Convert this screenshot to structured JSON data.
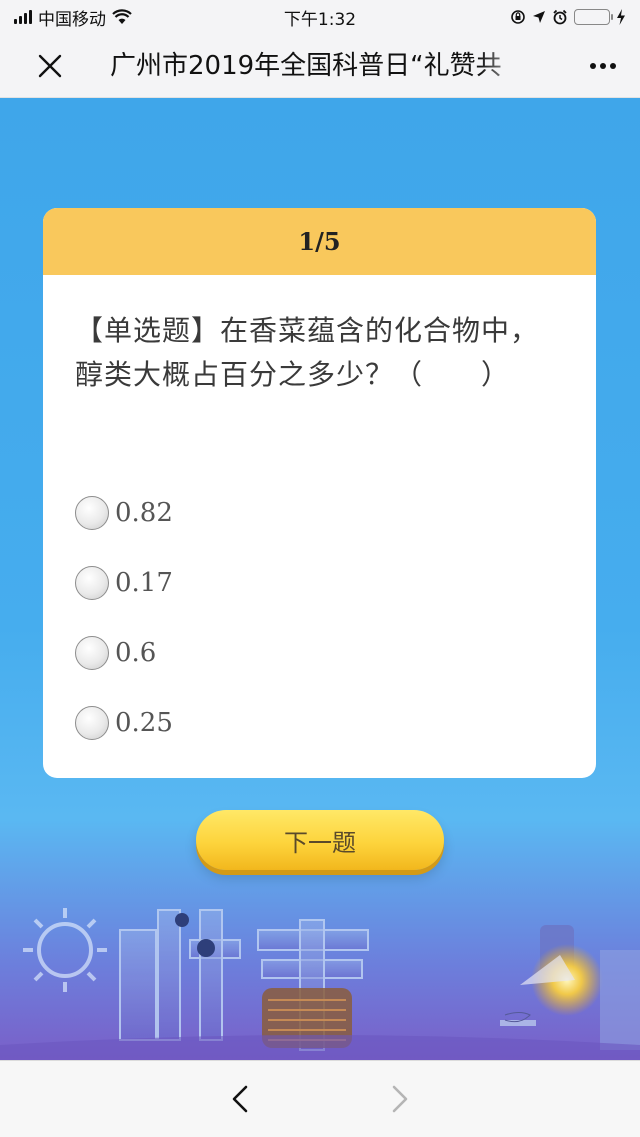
{
  "status_bar": {
    "carrier": "中国移动",
    "time": "下午1:32"
  },
  "nav_bar": {
    "title": "广州市2019年全国科普日“礼赞共"
  },
  "quiz": {
    "progress": "1/5",
    "question": "【单选题】在香菜蕴含的化合物中，醇类大概占百分之多少？（　　）",
    "options": [
      {
        "label": "0.82"
      },
      {
        "label": "0.17"
      },
      {
        "label": "0.6"
      },
      {
        "label": "0.25"
      }
    ],
    "next_button": "下一题"
  },
  "colors": {
    "header_yellow": "#f9c85c",
    "background_blue": "#46adee",
    "button_yellow": "#fdd43c"
  }
}
